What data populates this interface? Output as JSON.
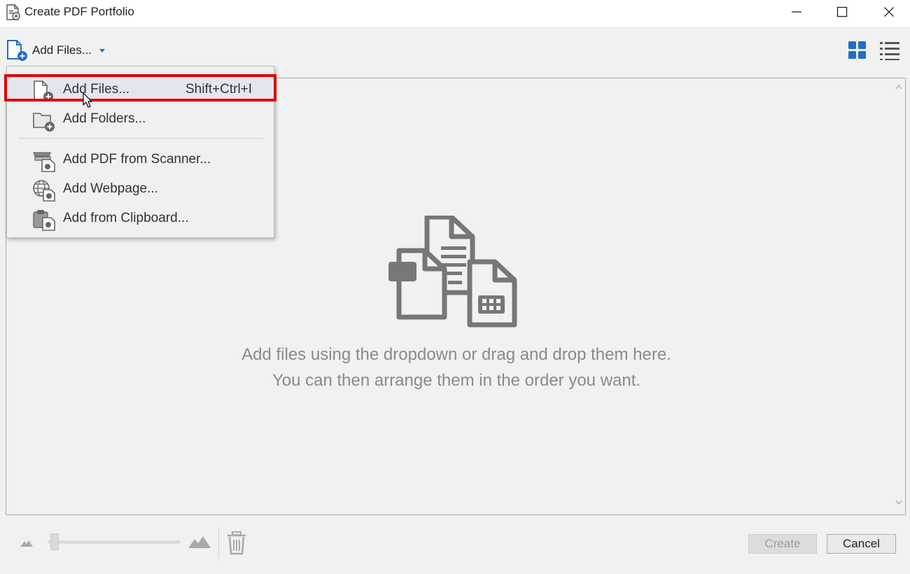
{
  "window": {
    "title": "Create PDF Portfolio",
    "controls": [
      "minimize-icon",
      "maximize-icon",
      "close-icon"
    ]
  },
  "toolbar": {
    "add_files_label": "Add Files...",
    "view_modes": [
      "grid-view-icon",
      "list-view-icon"
    ],
    "accent_color": "#1f6fc5"
  },
  "menu": {
    "items": [
      {
        "label": "Add Files...",
        "shortcut": "Shift+Ctrl+I",
        "icon": "add-file-icon",
        "highlighted": true
      },
      {
        "label": "Add Folders...",
        "icon": "add-folder-icon"
      },
      {
        "label": "Add PDF from Scanner...",
        "icon": "scanner-icon"
      },
      {
        "label": "Add Webpage...",
        "icon": "webpage-globe-icon"
      },
      {
        "label": "Add from Clipboard...",
        "icon": "clipboard-icon"
      }
    ],
    "highlight_color": "#e00000"
  },
  "content": {
    "empty_line1": "Add files using the dropdown or drag and drop them here.",
    "empty_line2": "You can then arrange them in the order you want."
  },
  "footer": {
    "create_label": "Create",
    "cancel_label": "Cancel",
    "create_enabled": false
  }
}
